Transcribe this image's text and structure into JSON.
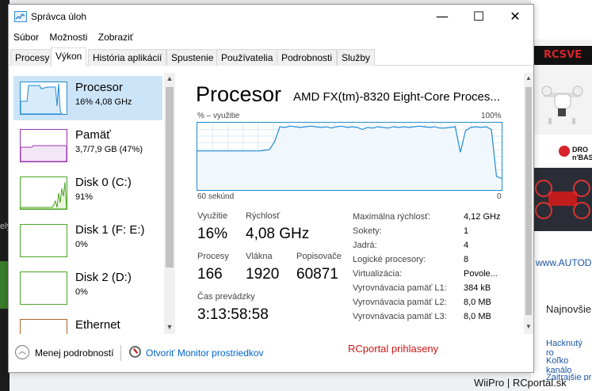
{
  "window": {
    "title": "Správca úloh",
    "controls": {
      "minimize": "—",
      "maximize": "☐",
      "close": "✕"
    }
  },
  "menu": [
    "Súbor",
    "Možnosti",
    "Zobraziť"
  ],
  "tabs": [
    "Procesy",
    "Výkon",
    "História aplikácií",
    "Spustenie",
    "Používatelia",
    "Podrobnosti",
    "Služby"
  ],
  "active_tab": "Výkon",
  "sidebar": [
    {
      "name": "Procesor",
      "value": "16% 4,08 GHz",
      "color": "#1f8ad2",
      "fill": "#d7ebfa",
      "selected": true
    },
    {
      "name": "Pamäť",
      "value": "3,7/7,9 GB (47%)",
      "color": "#9b34b1",
      "fill": "#f3e6f7",
      "selected": false
    },
    {
      "name": "Disk 0 (C:)",
      "value": "91%",
      "color": "#4da423",
      "fill": "#e9f5e1",
      "selected": false
    },
    {
      "name": "Disk 1 (F: E:)",
      "value": "0%",
      "color": "#4da423",
      "fill": "#e9f5e1",
      "selected": false
    },
    {
      "name": "Disk 2 (D:)",
      "value": "0%",
      "color": "#4da423",
      "fill": "#e9f5e1",
      "selected": false
    },
    {
      "name": "Ethernet",
      "value": "",
      "color": "#a7662b",
      "fill": "#f6ece1",
      "selected": false
    }
  ],
  "main": {
    "title": "Procesor",
    "cpu_name": "AMD FX(tm)-8320 Eight-Core Proces...",
    "graph_label_left": "% – využitie",
    "graph_label_right": "100%",
    "time_label": "60 sekúnd",
    "zero_label": "0",
    "stats": [
      {
        "label": "Využitie",
        "value": "16%"
      },
      {
        "label": "Rýchlosť",
        "value": "4,08 GHz"
      },
      {
        "label": "Procesy",
        "value": "166"
      },
      {
        "label": "Vlákna",
        "value": "1920"
      },
      {
        "label": "Popisovače",
        "value": "60871"
      },
      {
        "label": "Čas prevádzky",
        "value": "3:13:58:58"
      }
    ],
    "info": [
      {
        "label": "Maximálna rýchlosť:",
        "value": "4,12 GHz"
      },
      {
        "label": "Sokety:",
        "value": "1"
      },
      {
        "label": "Jadrá:",
        "value": "4"
      },
      {
        "label": "Logické procesory:",
        "value": "8"
      },
      {
        "label": "Virtualizácia:",
        "value": "Povole..."
      },
      {
        "label": "Vyrovnávacia pamäť L1:",
        "value": "384 kB"
      },
      {
        "label": "Vyrovnávacia pamäť L2:",
        "value": "8,0 MB"
      },
      {
        "label": "Vyrovnávacia pamäť L3:",
        "value": "8,0 MB"
      }
    ]
  },
  "cpu_graph_usage": [
    58,
    58,
    58,
    58,
    58,
    58,
    58,
    58,
    58,
    58,
    58,
    58,
    58,
    59,
    60,
    72,
    94,
    93,
    95,
    94,
    93,
    94,
    95,
    94,
    93,
    94,
    92,
    94,
    95,
    93,
    94,
    93,
    90,
    93,
    92,
    94,
    93,
    92,
    94,
    93,
    94,
    93,
    94,
    95,
    94,
    93,
    94,
    92,
    92,
    93,
    94,
    56,
    88,
    93,
    94,
    93,
    94,
    90,
    20,
    17
  ],
  "footer": {
    "fewer_details": "Menej podrobností",
    "resource_monitor": "Otvoriť Monitor prostriedkov",
    "note": "RCportal prihlaseny"
  },
  "background": {
    "brand_banner": "RCSVE",
    "ad_label": "DRO n'BAS",
    "link": "www.AUTODI",
    "heading": "Najnovšie",
    "items": [
      "Hacknutý ro",
      "Koľko kanálo",
      "Zaitrajšie pr"
    ],
    "credit": "WiiPro | RCportal.sk"
  },
  "colors": {
    "accent": "#1f8ad2",
    "link": "#0066cc",
    "note": "#d01515"
  }
}
